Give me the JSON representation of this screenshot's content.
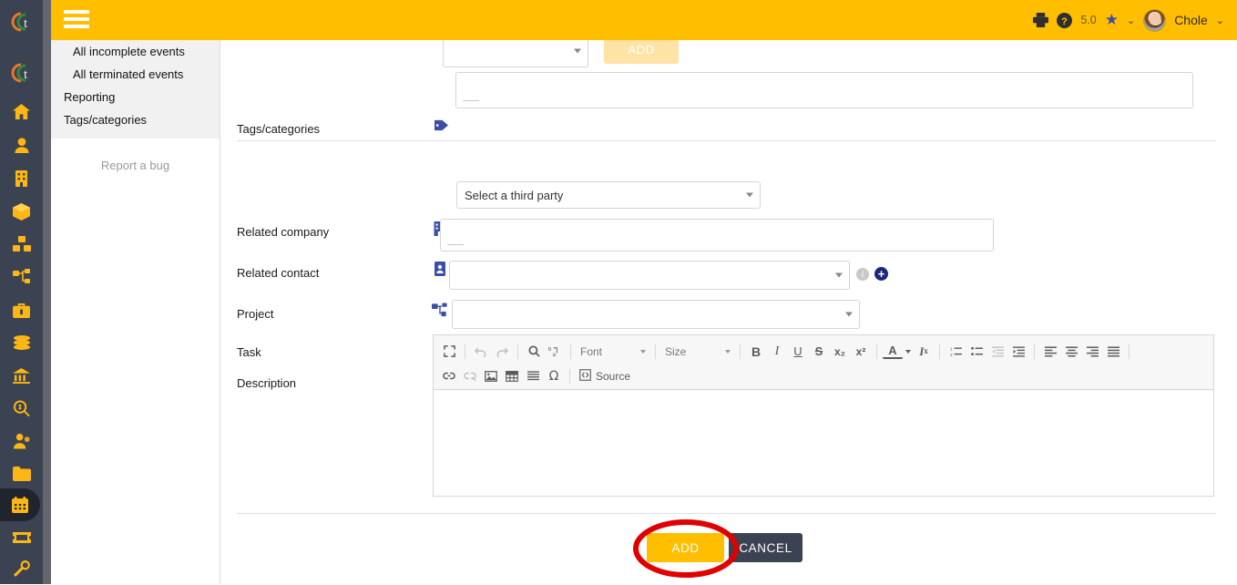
{
  "topbar": {
    "hamburger_icon": "hamburger-menu-icon",
    "print_icon": "printer-icon",
    "help_icon": "help-circle-icon",
    "version": "5.0",
    "star_icon": "star-icon",
    "caret_icon": "chevron-down-icon",
    "avatar_icon": "user-avatar",
    "username": "Chole",
    "user_caret_icon": "chevron-down-icon",
    "bg_color": "#ffbf00"
  },
  "rail": {
    "logo_alt": "dolibarr-logo",
    "bg_color": "#3b4252",
    "accent_color": "#fdb714",
    "items": [
      {
        "name": "home-icon"
      },
      {
        "name": "user-icon"
      },
      {
        "name": "building-icon"
      },
      {
        "name": "box-icon"
      },
      {
        "name": "stock-icon"
      },
      {
        "name": "network-icon"
      },
      {
        "name": "briefcase-icon"
      },
      {
        "name": "coins-icon"
      },
      {
        "name": "bank-icon"
      },
      {
        "name": "money-search-icon"
      },
      {
        "name": "hr-icon"
      },
      {
        "name": "folder-icon"
      },
      {
        "name": "calendar-icon"
      },
      {
        "name": "ticket-icon"
      },
      {
        "name": "wrench-icon"
      }
    ]
  },
  "menu": {
    "items": [
      {
        "label": "All incomplete events",
        "sub": true
      },
      {
        "label": "All terminated events",
        "sub": true
      },
      {
        "label": "Reporting",
        "sub": false
      },
      {
        "label": "Tags/categories",
        "sub": false
      }
    ],
    "report_bug": "Report a bug"
  },
  "form": {
    "top_add_label": "ADD",
    "tags_label": "Tags/categories",
    "tags_icon": "tag-icon",
    "tags_value": "",
    "related_company_label": "Related company",
    "related_company_icon": "building-icon",
    "related_company_value": "Select a third party",
    "related_contact_label": "Related contact",
    "related_contact_icon": "contact-card-icon",
    "related_contact_value": "",
    "project_label": "Project",
    "project_icon": "project-network-icon",
    "project_value": "",
    "project_info_icon": "info-icon",
    "project_add_icon": "plus-circle-icon",
    "task_label": "Task",
    "task_icon": "task-list-icon",
    "task_value": "",
    "description_label": "Description",
    "description_value": ""
  },
  "editor": {
    "row1": [
      {
        "name": "maximize-icon",
        "glyph": "⤡",
        "dim": false
      },
      {
        "sep": true
      },
      {
        "name": "undo-icon",
        "glyph": "↩",
        "dim": true
      },
      {
        "name": "redo-icon",
        "glyph": "↪",
        "dim": true
      },
      {
        "sep": true
      },
      {
        "name": "find-icon",
        "glyph": "🔍",
        "dim": false
      },
      {
        "name": "replace-icon",
        "glyph": "ᵇₐ",
        "dim": false
      },
      {
        "sep": true
      }
    ],
    "font_label": "Font",
    "size_label": "Size",
    "row1b": [
      {
        "name": "bold-icon",
        "glyph": "B",
        "dim": false
      },
      {
        "name": "italic-icon",
        "glyph": "I",
        "dim": false
      },
      {
        "name": "underline-icon",
        "glyph": "U",
        "dim": false
      },
      {
        "name": "strikethrough-icon",
        "glyph": "S",
        "dim": false
      },
      {
        "name": "subscript-icon",
        "glyph": "x₂",
        "dim": false
      },
      {
        "name": "superscript-icon",
        "glyph": "x²",
        "dim": false
      },
      {
        "sep": true
      },
      {
        "name": "text-color-icon",
        "glyph": "A",
        "dim": false
      },
      {
        "name": "remove-format-icon",
        "glyph": "Iₓ",
        "dim": false
      },
      {
        "sep": true
      },
      {
        "name": "numbered-list-icon",
        "glyph": "≣",
        "dim": false
      },
      {
        "name": "bulleted-list-icon",
        "glyph": "≡",
        "dim": false
      },
      {
        "name": "outdent-icon",
        "glyph": "≡",
        "dim": true
      },
      {
        "name": "indent-icon",
        "glyph": "≡",
        "dim": false
      },
      {
        "sep": true
      },
      {
        "name": "align-left-icon",
        "glyph": "≡",
        "dim": false
      },
      {
        "name": "align-center-icon",
        "glyph": "≡",
        "dim": false
      },
      {
        "name": "align-right-icon",
        "glyph": "≡",
        "dim": false
      },
      {
        "name": "justify-icon",
        "glyph": "≡",
        "dim": false
      }
    ],
    "row2": [
      {
        "name": "link-icon",
        "glyph": "🔗",
        "dim": false
      },
      {
        "name": "unlink-icon",
        "glyph": "🔗",
        "dim": true
      },
      {
        "name": "image-icon",
        "glyph": "🖼",
        "dim": false
      },
      {
        "name": "table-icon",
        "glyph": "▦",
        "dim": false
      },
      {
        "name": "horizontal-rule-icon",
        "glyph": "≡",
        "dim": false
      },
      {
        "name": "special-char-icon",
        "glyph": "Ω",
        "dim": false
      },
      {
        "sep": true
      }
    ],
    "source_label": "Source",
    "source_icon": "source-code-icon"
  },
  "footer": {
    "add_label": "ADD",
    "cancel_label": "CANCEL",
    "add_color": "#ffbf00",
    "cancel_color": "#3b4252"
  },
  "annotation": {
    "shape": "ellipse",
    "color": "#e00000",
    "target": "ADD"
  }
}
